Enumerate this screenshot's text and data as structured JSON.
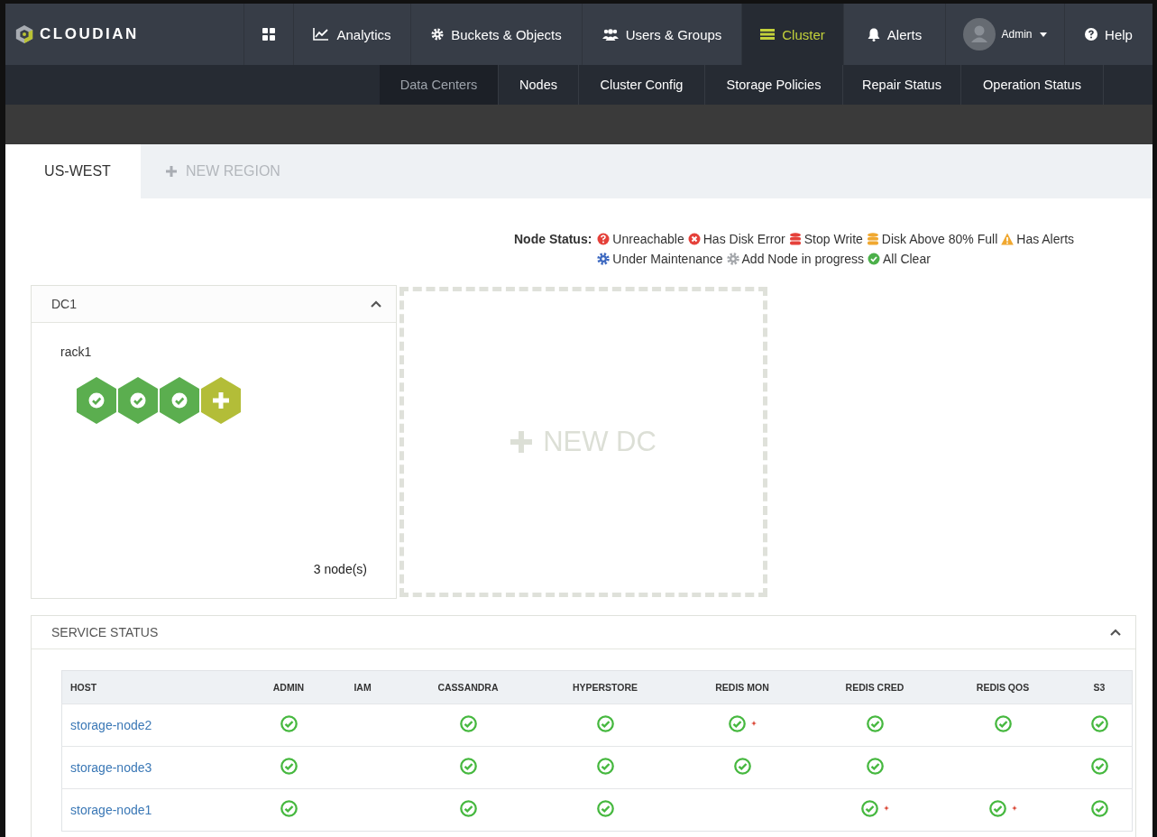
{
  "brand": {
    "name": "CLOUDIAN"
  },
  "nav": [
    {
      "kind": "apps",
      "selected": false
    },
    {
      "kind": "chart",
      "label": "Analytics",
      "selected": false
    },
    {
      "kind": "gear",
      "label": "Buckets & Objects",
      "selected": false
    },
    {
      "kind": "users",
      "label": "Users & Groups",
      "selected": false
    },
    {
      "kind": "cluster",
      "label": "Cluster",
      "selected": true
    },
    {
      "kind": "bell",
      "label": "Alerts",
      "selected": false
    },
    {
      "kind": "user",
      "label": "Admin",
      "selected": false
    },
    {
      "kind": "help",
      "label": "Help",
      "selected": false
    }
  ],
  "subnav": [
    {
      "label": "Data Centers",
      "selected": true
    },
    {
      "label": "Nodes",
      "selected": false
    },
    {
      "label": "Cluster Config",
      "selected": false
    },
    {
      "label": "Storage Policies",
      "selected": false
    },
    {
      "label": "Repair Status",
      "selected": false
    },
    {
      "label": "Operation Status",
      "selected": false
    }
  ],
  "region_tabs": [
    {
      "label": "US-WEST",
      "selected": true,
      "kind": "region"
    },
    {
      "label": "NEW REGION",
      "selected": false,
      "kind": "add"
    }
  ],
  "legend": {
    "title": "Node Status:",
    "items": [
      {
        "kind": "unreachable",
        "label": "Unreachable"
      },
      {
        "kind": "disk-error",
        "label": "Has Disk Error"
      },
      {
        "kind": "stop-write",
        "label": "Stop Write"
      },
      {
        "kind": "disk-full",
        "label": "Disk Above 80% Full"
      },
      {
        "kind": "alerts",
        "label": "Has Alerts"
      },
      {
        "kind": "maintenance",
        "label": "Under Maintenance"
      },
      {
        "kind": "adding",
        "label": "Add Node in progress"
      },
      {
        "kind": "clear",
        "label": "All Clear"
      }
    ]
  },
  "datacenter": {
    "title": "DC1",
    "expanded": true,
    "rack": "rack1",
    "nodes": [
      {
        "kind": "clear"
      },
      {
        "kind": "clear"
      },
      {
        "kind": "clear"
      },
      {
        "kind": "add"
      }
    ],
    "count": "3 node(s)"
  },
  "new_dc": {
    "label": "NEW DC"
  },
  "service_status": {
    "title": "SERVICE STATUS",
    "expanded": true,
    "columns": [
      "HOST",
      "ADMIN",
      "IAM",
      "CASSANDRA",
      "HYPERSTORE",
      "REDIS MON",
      "REDIS CRED",
      "REDIS QOS",
      "S3"
    ],
    "rows": [
      {
        "host": "storage-node2",
        "cells": [
          {
            "running": true,
            "flagged": false
          },
          {
            "running": false,
            "flagged": false
          },
          {
            "running": true,
            "flagged": false
          },
          {
            "running": true,
            "flagged": false
          },
          {
            "running": true,
            "flagged": true
          },
          {
            "running": true,
            "flagged": false
          },
          {
            "running": true,
            "flagged": false
          },
          {
            "running": true,
            "flagged": false
          }
        ]
      },
      {
        "host": "storage-node3",
        "cells": [
          {
            "running": true,
            "flagged": false
          },
          {
            "running": false,
            "flagged": false
          },
          {
            "running": true,
            "flagged": false
          },
          {
            "running": true,
            "flagged": false
          },
          {
            "running": true,
            "flagged": false
          },
          {
            "running": true,
            "flagged": false
          },
          {
            "running": false,
            "flagged": false
          },
          {
            "running": true,
            "flagged": false
          }
        ]
      },
      {
        "host": "storage-node1",
        "cells": [
          {
            "running": true,
            "flagged": false
          },
          {
            "running": false,
            "flagged": false
          },
          {
            "running": true,
            "flagged": false
          },
          {
            "running": true,
            "flagged": false
          },
          {
            "running": false,
            "flagged": false
          },
          {
            "running": true,
            "flagged": true
          },
          {
            "running": true,
            "flagged": true
          },
          {
            "running": true,
            "flagged": false
          }
        ]
      }
    ]
  }
}
